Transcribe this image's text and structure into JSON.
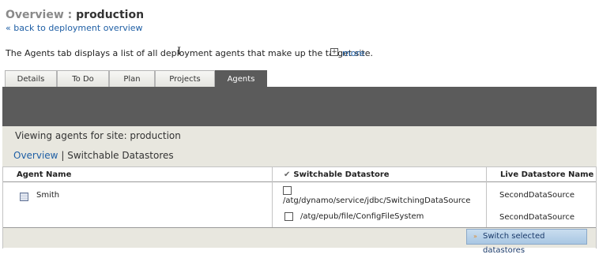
{
  "header": {
    "title_prefix": "Overview : ",
    "title_env": "production",
    "back_link": "« back to deployment overview"
  },
  "intro": {
    "description": "The Agents tab displays a list of all deployment agents that make up the target site.",
    "more_icon": "+",
    "more_link": "more"
  },
  "tabs": [
    {
      "label": "Details",
      "active": false
    },
    {
      "label": "To Do",
      "active": false
    },
    {
      "label": "Plan",
      "active": false
    },
    {
      "label": "Projects",
      "active": false
    },
    {
      "label": "Agents",
      "active": true
    }
  ],
  "panel": {
    "viewing": "Viewing agents for site: production",
    "link_overview": "Overview",
    "separator": "|",
    "switchable": "Switchable Datastores"
  },
  "table": {
    "col_agent": "Agent Name",
    "col_switchable_icon": "✔",
    "col_switchable": "Switchable Datastore",
    "col_live": "Live Datastore Name",
    "agent": "Smith",
    "rows": [
      {
        "datastore": "/atg/dynamo/service/jdbc/SwitchingDataSource",
        "live": "SecondDataSource",
        "checked": false
      },
      {
        "datastore": "/atg/epub/file/ConfigFileSystem",
        "live": "SecondDataSource",
        "checked": false
      }
    ]
  },
  "footer": {
    "button_icon": "»",
    "button_label": "Switch selected datastores"
  },
  "colors": {
    "link": "#1f5fa5",
    "dark_bar": "#5b5b5b",
    "panel_bg": "#e8e7df",
    "button_bg": "#b9d3ea"
  }
}
